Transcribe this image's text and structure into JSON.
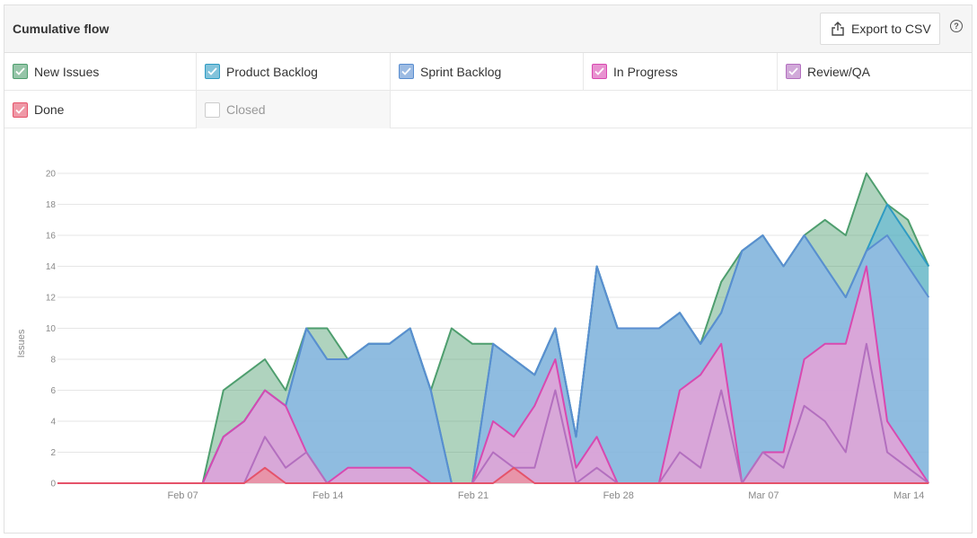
{
  "header": {
    "title": "Cumulative flow",
    "export_label": "Export to CSV",
    "export_icon": "upload-icon",
    "help_icon": "question-circle-icon",
    "help_glyph": "?"
  },
  "legend": [
    {
      "label": "New Issues",
      "color": "#4e9e6e",
      "checked": true
    },
    {
      "label": "Product Backlog",
      "color": "#2f9bc3",
      "checked": true
    },
    {
      "label": "Sprint Backlog",
      "color": "#5a8ed0",
      "checked": true
    },
    {
      "label": "In Progress",
      "color": "#d849b0",
      "checked": true
    },
    {
      "label": "Review/QA",
      "color": "#b36fbf",
      "checked": true
    },
    {
      "label": "Done",
      "color": "#e5536a",
      "checked": true
    },
    {
      "label": "Closed",
      "color": "#cccccc",
      "checked": false
    }
  ],
  "chart_data": {
    "type": "area",
    "title": "Cumulative flow",
    "xlabel": "",
    "ylabel": "Issues",
    "ylim": [
      0,
      20
    ],
    "yticks": [
      0,
      2,
      4,
      6,
      8,
      10,
      12,
      14,
      16,
      18,
      20
    ],
    "x_start": "Feb 01",
    "x_end": "Mar 15",
    "xtick_labels": [
      {
        "label": "Feb 07",
        "day": 6
      },
      {
        "label": "Feb 14",
        "day": 13
      },
      {
        "label": "Feb 21",
        "day": 20
      },
      {
        "label": "Feb 28",
        "day": 27
      },
      {
        "label": "Mar 07",
        "day": 34
      },
      {
        "label": "Mar 14",
        "day": 41
      }
    ],
    "grid": true,
    "series": [
      {
        "name": "New Issues",
        "color": "#4e9e6e",
        "fill": "rgba(78,158,110,0.45)",
        "values": [
          0,
          0,
          0,
          0,
          0,
          0,
          0,
          0,
          6,
          7,
          8,
          6,
          10,
          10,
          8,
          9,
          9,
          10,
          6,
          10,
          9,
          9,
          8,
          7,
          10,
          3,
          14,
          10,
          10,
          10,
          11,
          9,
          13,
          15,
          16,
          14,
          16,
          17,
          16,
          20,
          18,
          17,
          14
        ]
      },
      {
        "name": "Product Backlog",
        "color": "#2f9bc3",
        "fill": "rgba(84,180,220,0.55)",
        "values": [
          0,
          0,
          0,
          0,
          0,
          0,
          0,
          0,
          3,
          4,
          6,
          5,
          10,
          8,
          8,
          9,
          9,
          10,
          6,
          0,
          0,
          9,
          8,
          7,
          10,
          3,
          14,
          10,
          10,
          10,
          11,
          9,
          11,
          15,
          16,
          14,
          16,
          14,
          12,
          15,
          18,
          16,
          14
        ]
      },
      {
        "name": "Sprint Backlog",
        "color": "#5a8ed0",
        "fill": "rgba(150,185,230,0.75)",
        "values": [
          0,
          0,
          0,
          0,
          0,
          0,
          0,
          0,
          3,
          4,
          6,
          5,
          10,
          8,
          8,
          9,
          9,
          10,
          6,
          0,
          0,
          9,
          8,
          7,
          10,
          3,
          14,
          10,
          10,
          10,
          11,
          9,
          11,
          15,
          16,
          14,
          16,
          14,
          12,
          15,
          16,
          14,
          12
        ]
      },
      {
        "name": "In Progress",
        "color": "#d849b0",
        "fill": "rgba(235,160,215,0.8)",
        "values": [
          0,
          0,
          0,
          0,
          0,
          0,
          0,
          0,
          3,
          4,
          6,
          5,
          2,
          0,
          1,
          1,
          1,
          1,
          0,
          0,
          0,
          4,
          3,
          5,
          8,
          1,
          3,
          0,
          0,
          0,
          6,
          7,
          9,
          0,
          2,
          2,
          8,
          9,
          9,
          14,
          4,
          2,
          0
        ]
      },
      {
        "name": "Review/QA",
        "color": "#b36fbf",
        "fill": "rgba(215,170,215,0.6)",
        "values": [
          0,
          0,
          0,
          0,
          0,
          0,
          0,
          0,
          0,
          0,
          3,
          1,
          2,
          0,
          0,
          0,
          0,
          0,
          0,
          0,
          0,
          2,
          1,
          1,
          6,
          0,
          1,
          0,
          0,
          0,
          2,
          1,
          6,
          0,
          2,
          1,
          5,
          4,
          2,
          9,
          2,
          1,
          0
        ]
      },
      {
        "name": "Done",
        "color": "#e5536a",
        "fill": "rgba(240,140,150,0.7)",
        "values": [
          0,
          0,
          0,
          0,
          0,
          0,
          0,
          0,
          0,
          0,
          1,
          0,
          0,
          0,
          0,
          0,
          0,
          0,
          0,
          0,
          0,
          0,
          1,
          0,
          0,
          0,
          0,
          0,
          0,
          0,
          0,
          0,
          0,
          0,
          0,
          0,
          0,
          0,
          0,
          0,
          0,
          0,
          0
        ]
      },
      {
        "name": "Closed",
        "color": "#cccccc",
        "hidden": true,
        "values": []
      }
    ]
  }
}
